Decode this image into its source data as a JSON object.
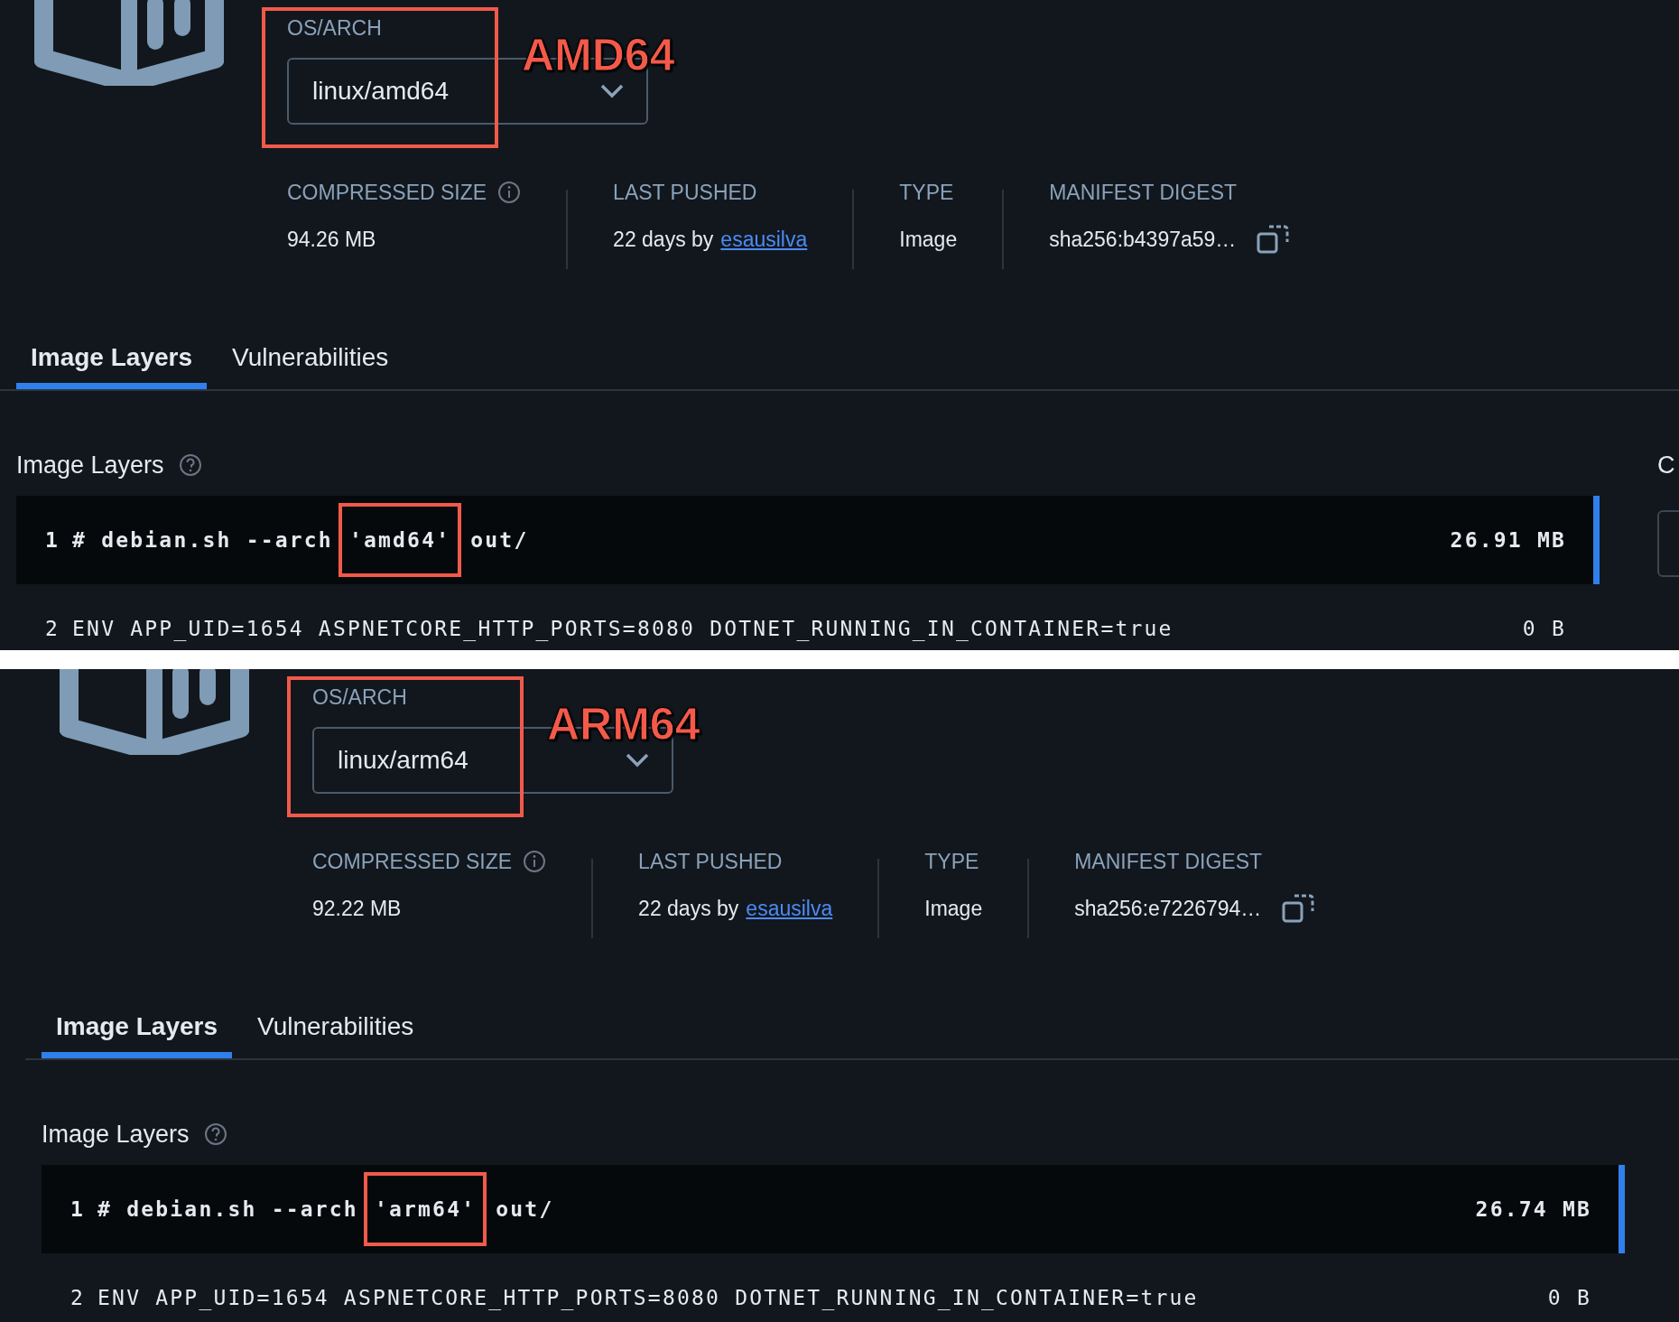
{
  "panels": [
    {
      "annotation": "AMD64",
      "os_arch": {
        "label": "OS/ARCH",
        "value": "linux/amd64"
      },
      "stats": [
        {
          "kind": "size",
          "label": "COMPRESSED SIZE",
          "value": "94.26 MB"
        },
        {
          "kind": "pushed",
          "label": "LAST PUSHED",
          "value": "22 days by",
          "link": "esausilva"
        },
        {
          "kind": "type",
          "label": "TYPE",
          "value": "Image"
        },
        {
          "kind": "digest",
          "label": "MANIFEST DIGEST",
          "value": "sha256:b4397a59…"
        }
      ],
      "tabs": [
        {
          "label": "Image Layers",
          "selected": true
        },
        {
          "label": "Vulnerabilities",
          "selected": false
        }
      ],
      "section_title": "Image Layers",
      "side_heading": "C",
      "layers": [
        {
          "number": "1",
          "before": "# debian.sh --arch",
          "highlight": "'amd64'",
          "after": "out/",
          "size": "26.91 MB",
          "selected": true
        },
        {
          "number": "2",
          "before": "ENV APP_UID=1654 ASPNETCORE_HTTP_PORTS=8080 DOTNET_RUNNING_IN_CONTAINER=true",
          "size": "0 B",
          "selected": false
        }
      ]
    },
    {
      "annotation": "ARM64",
      "os_arch": {
        "label": "OS/ARCH",
        "value": "linux/arm64"
      },
      "stats": [
        {
          "kind": "size",
          "label": "COMPRESSED SIZE",
          "value": "92.22 MB"
        },
        {
          "kind": "pushed",
          "label": "LAST PUSHED",
          "value": "22 days by",
          "link": "esausilva"
        },
        {
          "kind": "type",
          "label": "TYPE",
          "value": "Image"
        },
        {
          "kind": "digest",
          "label": "MANIFEST DIGEST",
          "value": "sha256:e7226794…"
        }
      ],
      "tabs": [
        {
          "label": "Image Layers",
          "selected": true
        },
        {
          "label": "Vulnerabilities",
          "selected": false
        }
      ],
      "section_title": "Image Layers",
      "layers": [
        {
          "number": "1",
          "before": "# debian.sh --arch",
          "highlight": "'arm64'",
          "after": "out/",
          "size": "26.74 MB",
          "selected": true
        },
        {
          "number": "2",
          "before": "ENV APP_UID=1654 ASPNETCORE_HTTP_PORTS=8080 DOTNET_RUNNING_IN_CONTAINER=true",
          "size": "0 B",
          "selected": false
        }
      ]
    }
  ]
}
